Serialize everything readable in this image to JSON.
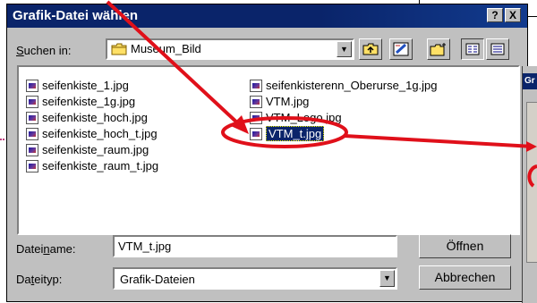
{
  "dialog": {
    "title": "Grafik-Datei wählen",
    "help_label": "?",
    "close_label": "X"
  },
  "lookin": {
    "label_prefix": "S",
    "label_rest": "uchen in:",
    "folder": "Museum_Bild"
  },
  "files": {
    "col1": [
      "seifenkiste_1.jpg",
      "seifenkiste_1g.jpg",
      "seifenkiste_hoch.jpg",
      "seifenkiste_hoch_t.jpg",
      "seifenkiste_raum.jpg",
      "seifenkiste_raum_t.jpg"
    ],
    "col2": [
      "seifenkisterenn_Oberurse_1g.jpg",
      "VTM.jpg",
      "VTM_Logo.jpg",
      "VTM_t.jpg"
    ],
    "selected": "VTM_t.jpg"
  },
  "filename": {
    "label_a": "Datei",
    "label_u": "n",
    "label_b": "ame:",
    "value": "VTM_t.jpg"
  },
  "filetype": {
    "label_a": "Da",
    "label_u": "t",
    "label_b": "eityp:",
    "value": "Grafik-Dateien"
  },
  "buttons": {
    "open": "Öffnen",
    "cancel": "Abbrechen"
  },
  "background_window": {
    "title_fragment": "Gr"
  },
  "colors": {
    "titlebar": "#0a246a",
    "annotation": "#e0101a",
    "face": "#c0c0c0"
  }
}
